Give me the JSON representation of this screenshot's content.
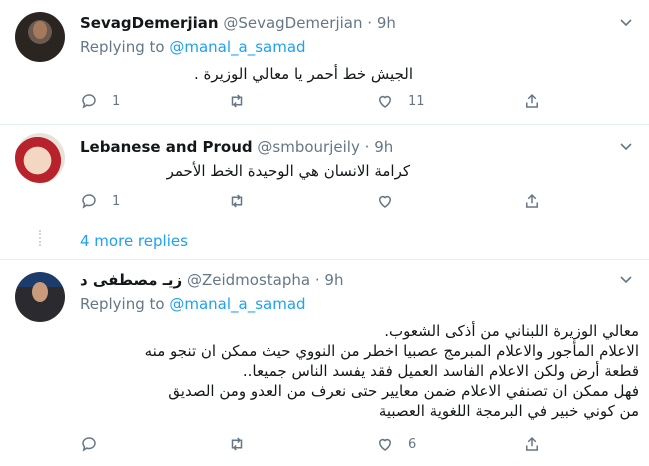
{
  "tweets": [
    {
      "name": "SevagDemerjian",
      "handle": "@SevagDemerjian",
      "dot": "·",
      "time": "9h",
      "replying_prefix": "Replying to ",
      "replying_to": "@manal_a_samad",
      "text_lines": [
        "الجيش خط أحمر  يا معالي الوزيرة ."
      ],
      "replies": "1",
      "retweets": "",
      "likes": "11"
    },
    {
      "name": "Lebanese and Proud",
      "handle": "@smbourjeily",
      "dot": "·",
      "time": "9h",
      "text_lines": [
        "كرامة الانسان هي الوحيدة الخط الأحمر"
      ],
      "replies": "1",
      "retweets": "",
      "likes": ""
    },
    {
      "name": "زيـ مصطفى د",
      "handle": "@Zeidmostapha",
      "dot": "·",
      "time": "9h",
      "replying_prefix": "Replying to ",
      "replying_to": "@manal_a_samad",
      "text_lines": [
        "معالي الوزيرة اللبناني من أذكى الشعوب.",
        "الاعلام المأجور والاعلام المبرمج عصبيا اخطر من النووي حيث ممكن ان تنجو منه",
        "قطعة أرض ولكن الاعلام الفاسد العميل  فقد يفسد الناس جميعا..",
        "فهل ممكن ان تصنفي الاعلام ضمن معايير حتى نعرف من العدو ومن الصديق",
        "من كوني خبير في البرمجة اللغوية العصبية"
      ],
      "replies": "",
      "retweets": "",
      "likes": "6"
    }
  ],
  "more_replies": "4 more replies",
  "icons": [
    "reply-icon",
    "retweet-icon",
    "like-icon",
    "share-icon",
    "caret-down-icon"
  ],
  "colors": {
    "link": "#1da1f2",
    "muted": "#657786",
    "separator": "#e6ecf0"
  }
}
